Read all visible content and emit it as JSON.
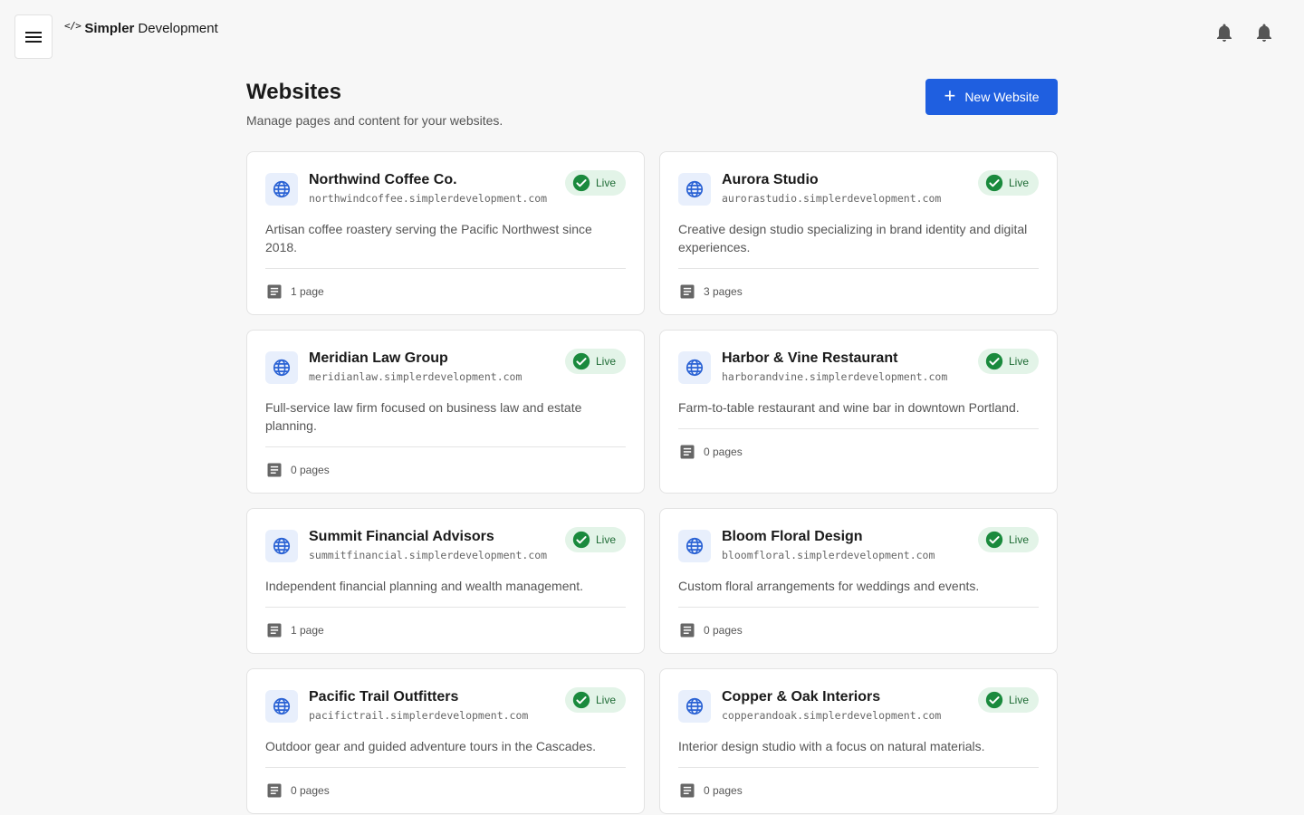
{
  "app": {
    "brand_mark": "</>",
    "brand_bold": "Simpler",
    "brand_rest": "Development"
  },
  "colors": {
    "accent": "#1f5fe0",
    "live_bg": "#e3f4e8",
    "live_icon": "#1a8a3d",
    "globe": "#2a62d4"
  },
  "header": {
    "title": "Websites",
    "subtitle": "Manage pages and content for your websites.",
    "new_button": "New Website"
  },
  "sites": [
    {
      "name": "Northwind Coffee Co.",
      "domain": "northwindcoffee.simplerdevelopment.com",
      "status": "Live",
      "description": "Artisan coffee roastery serving the Pacific Northwest since 2018.",
      "pages": "1 page"
    },
    {
      "name": "Aurora Studio",
      "domain": "aurorastudio.simplerdevelopment.com",
      "status": "Live",
      "description": "Creative design studio specializing in brand identity and digital experiences.",
      "pages": "3 pages"
    },
    {
      "name": "Meridian Law Group",
      "domain": "meridianlaw.simplerdevelopment.com",
      "status": "Live",
      "description": "Full-service law firm focused on business law and estate planning.",
      "pages": "0 pages"
    },
    {
      "name": "Harbor & Vine Restaurant",
      "domain": "harborandvine.simplerdevelopment.com",
      "status": "Live",
      "description": "Farm-to-table restaurant and wine bar in downtown Portland.",
      "pages": "0 pages"
    },
    {
      "name": "Summit Financial Advisors",
      "domain": "summitfinancial.simplerdevelopment.com",
      "status": "Live",
      "description": "Independent financial planning and wealth management.",
      "pages": "1 page"
    },
    {
      "name": "Bloom Floral Design",
      "domain": "bloomfloral.simplerdevelopment.com",
      "status": "Live",
      "description": "Custom floral arrangements for weddings and events.",
      "pages": "0 pages"
    },
    {
      "name": "Pacific Trail Outfitters",
      "domain": "pacifictrail.simplerdevelopment.com",
      "status": "Live",
      "description": "Outdoor gear and guided adventure tours in the Cascades.",
      "pages": "0 pages"
    },
    {
      "name": "Copper & Oak Interiors",
      "domain": "copperandoak.simplerdevelopment.com",
      "status": "Live",
      "description": "Interior design studio with a focus on natural materials.",
      "pages": "0 pages"
    }
  ]
}
